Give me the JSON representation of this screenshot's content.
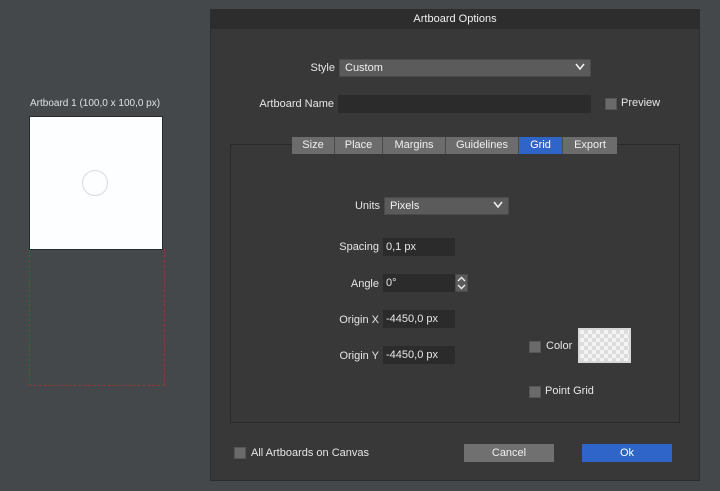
{
  "canvas": {
    "artboard_label": "Artboard 1 (100,0 x 100,0 px)"
  },
  "dialog": {
    "title": "Artboard Options",
    "style_label": "Style",
    "style_value": "Custom",
    "name_label": "Artboard Name",
    "name_value": "",
    "preview_label": "Preview",
    "tabs": [
      "Size",
      "Place",
      "Margins",
      "Guidelines",
      "Grid",
      "Export"
    ],
    "active_tab": "Grid",
    "grid": {
      "units_label": "Units",
      "units_value": "Pixels",
      "spacing_label": "Spacing",
      "spacing_value": "0,1 px",
      "angle_label": "Angle",
      "angle_value": "0°",
      "origin_x_label": "Origin X",
      "origin_x_value": "-4450,0 px",
      "origin_y_label": "Origin Y",
      "origin_y_value": "-4450,0 px",
      "color_label": "Color",
      "point_grid_label": "Point Grid"
    },
    "all_artboards_label": "All Artboards on Canvas",
    "cancel_label": "Cancel",
    "ok_label": "Ok"
  },
  "colors": {
    "accent": "#2f64c8",
    "dialog_bg": "#383838",
    "canvas_bg": "#45484b"
  }
}
